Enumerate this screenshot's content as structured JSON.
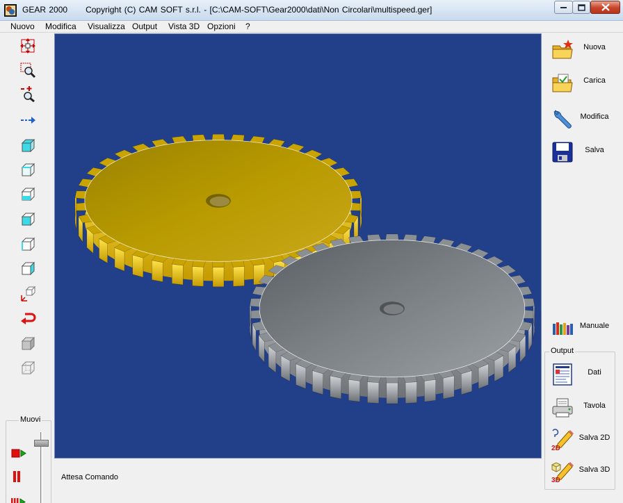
{
  "window": {
    "app_name": "GEAR 2000",
    "title": "Copyright (C)  CAM SOFT s.r.l. - [C:\\CAM-SOFT\\Gear2000\\dati\\Non Circolari\\multispeed.ger]"
  },
  "menu": {
    "items": [
      "Nuovo",
      "Modifica",
      "Visualizza",
      "Output",
      "Vista 3D",
      "Opzioni",
      "?"
    ]
  },
  "left_toolbar": {
    "icons": [
      "pan-icon",
      "zoom-window-icon",
      "zoom-in-out-icon",
      "arrow-right-icon",
      "view-cube-top-icon",
      "view-cube-front-icon",
      "view-cube-side-icon",
      "view-cube-iso-icon",
      "view-cube-left-icon",
      "view-cube-right-icon",
      "axes-icon",
      "undo-icon",
      "cube-solid-icon",
      "cube-wire-icon"
    ],
    "move_group": {
      "label": "Muovi",
      "icons": [
        "play-icon",
        "pause-icon",
        "fast-forward-icon"
      ],
      "slider_level": 0.1
    }
  },
  "right_panel": {
    "nuova": "Nuova",
    "carica": "Carica",
    "modifica": "Modifica",
    "salva": "Salva",
    "manuale": "Manuale",
    "output_group": {
      "label": "Output",
      "dati": "Dati",
      "tavola": "Tavola",
      "salva_2d": "Salva 2D",
      "salva_3d": "Salva 3D"
    }
  },
  "status": {
    "text": "Attesa Comando"
  },
  "viewport": {
    "background_color": "#22408a",
    "gear_colors": {
      "gold": "#c9a400",
      "gray": "#8a8f93"
    }
  }
}
